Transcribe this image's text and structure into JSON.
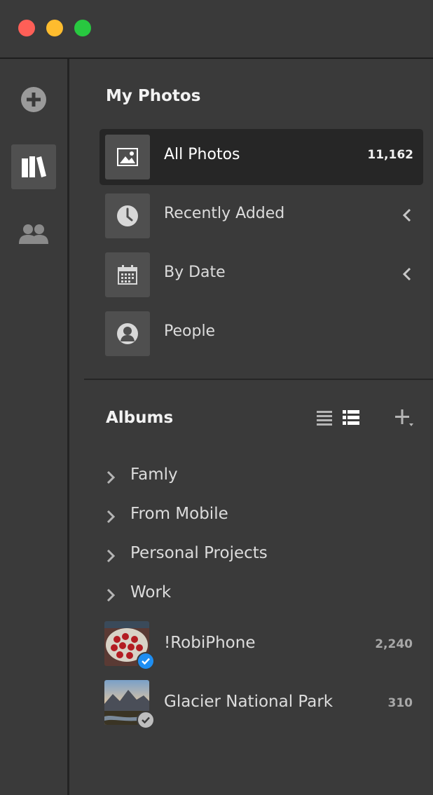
{
  "window": {
    "controls": [
      "close",
      "minimize",
      "maximize"
    ]
  },
  "rail": {
    "items": [
      {
        "icon": "add-icon",
        "active": false
      },
      {
        "icon": "library-icon",
        "active": true
      },
      {
        "icon": "people-icon",
        "active": false
      }
    ]
  },
  "my_photos": {
    "title": "My Photos",
    "items": [
      {
        "label": "All Photos",
        "count": "11,162",
        "icon": "image-icon",
        "active": true
      },
      {
        "label": "Recently Added",
        "icon": "clock-icon",
        "expandable": true
      },
      {
        "label": "By Date",
        "icon": "calendar-icon",
        "expandable": true
      },
      {
        "label": "People",
        "icon": "person-icon"
      }
    ]
  },
  "albums": {
    "title": "Albums",
    "view_modes": [
      "list-view-icon",
      "detail-list-view-icon"
    ],
    "selected_view": "detail-list-view-icon",
    "folders": [
      {
        "label": "Famly"
      },
      {
        "label": "From Mobile"
      },
      {
        "label": "Personal Projects"
      },
      {
        "label": "Work"
      }
    ],
    "items": [
      {
        "label": "!RobiPhone",
        "count": "2,240",
        "status": "synced-active",
        "badge_color": "#1e8ef2"
      },
      {
        "label": "Glacier National Park",
        "count": "310",
        "status": "synced",
        "badge_color": "#bdbdbd"
      }
    ]
  }
}
